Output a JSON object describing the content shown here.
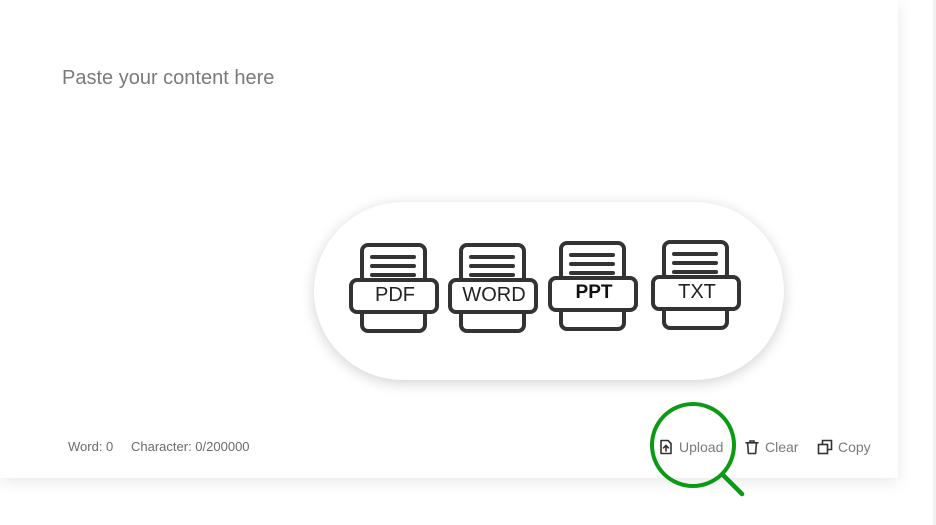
{
  "editor": {
    "placeholder": "Paste your content here",
    "value": ""
  },
  "formats": [
    {
      "label": "PDF",
      "icon": "pdf-file-icon"
    },
    {
      "label": "WORD",
      "icon": "word-file-icon"
    },
    {
      "label": "PPT",
      "icon": "ppt-file-icon"
    },
    {
      "label": "TXT",
      "icon": "txt-file-icon"
    }
  ],
  "status": {
    "words": "Word: 0",
    "characters": "Character: 0/200000"
  },
  "actions": {
    "upload": "Upload",
    "clear": "Clear",
    "copy": "Copy"
  },
  "colors": {
    "highlight_ring": "#0a9a14",
    "icon_stroke": "#333333",
    "action_text": "#7a7a7a"
  }
}
